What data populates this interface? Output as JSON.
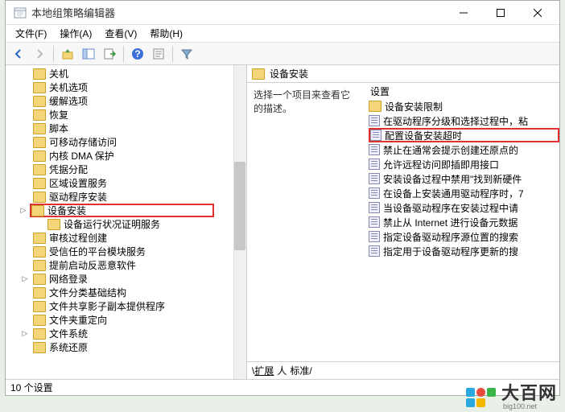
{
  "window": {
    "title": "本地组策略编辑器"
  },
  "menubar": [
    {
      "label": "文件(F)"
    },
    {
      "label": "操作(A)"
    },
    {
      "label": "查看(V)"
    },
    {
      "label": "帮助(H)"
    }
  ],
  "tree": {
    "items": [
      {
        "label": "关机",
        "expandable": false
      },
      {
        "label": "关机选项",
        "expandable": false
      },
      {
        "label": "缓解选项",
        "expandable": false
      },
      {
        "label": "恢复",
        "expandable": false
      },
      {
        "label": "脚本",
        "expandable": false
      },
      {
        "label": "可移动存储访问",
        "expandable": false
      },
      {
        "label": "内核 DMA 保护",
        "expandable": false
      },
      {
        "label": "凭据分配",
        "expandable": false
      },
      {
        "label": "区域设置服务",
        "expandable": false
      },
      {
        "label": "驱动程序安装",
        "expandable": false
      },
      {
        "label": "设备安装",
        "expandable": true,
        "highlighted": true
      },
      {
        "label": "设备运行状况证明服务",
        "expandable": false,
        "indent": true
      },
      {
        "label": "审核过程创建",
        "expandable": false
      },
      {
        "label": "受信任的平台模块服务",
        "expandable": false
      },
      {
        "label": "提前启动反恶意软件",
        "expandable": false
      },
      {
        "label": "网络登录",
        "expandable": true
      },
      {
        "label": "文件分类基础结构",
        "expandable": false
      },
      {
        "label": "文件共享影子副本提供程序",
        "expandable": false
      },
      {
        "label": "文件夹重定向",
        "expandable": false
      },
      {
        "label": "文件系统",
        "expandable": true
      },
      {
        "label": "系统还原",
        "expandable": false
      }
    ]
  },
  "detail": {
    "heading": "设备安装",
    "prompt": "选择一个项目来查看它的描述。",
    "column_header": "设置",
    "settings": [
      {
        "type": "folder",
        "label": "设备安装限制"
      },
      {
        "type": "cfg",
        "label": "在驱动程序分级和选择过程中，粘"
      },
      {
        "type": "cfg",
        "label": "配置设备安装超时",
        "highlighted": true
      },
      {
        "type": "cfg",
        "label": "禁止在通常会提示创建还原点的"
      },
      {
        "type": "cfg",
        "label": "允许远程访问即插即用接口"
      },
      {
        "type": "cfg",
        "label": "安装设备过程中禁用\"找到新硬件"
      },
      {
        "type": "cfg",
        "label": "在设备上安装通用驱动程序时，7"
      },
      {
        "type": "cfg",
        "label": "当设备驱动程序在安装过程中请"
      },
      {
        "type": "cfg",
        "label": "禁止从 Internet 进行设备元数据"
      },
      {
        "type": "cfg",
        "label": "指定设备驱动程序源位置的搜索"
      },
      {
        "type": "cfg",
        "label": "指定用于设备驱动程序更新的搜"
      }
    ],
    "tabs": {
      "extended": "扩展",
      "standard": "标准"
    }
  },
  "statusbar": {
    "text": "10 个设置"
  },
  "watermark": {
    "main": "大百网",
    "sub": "big100.net"
  }
}
